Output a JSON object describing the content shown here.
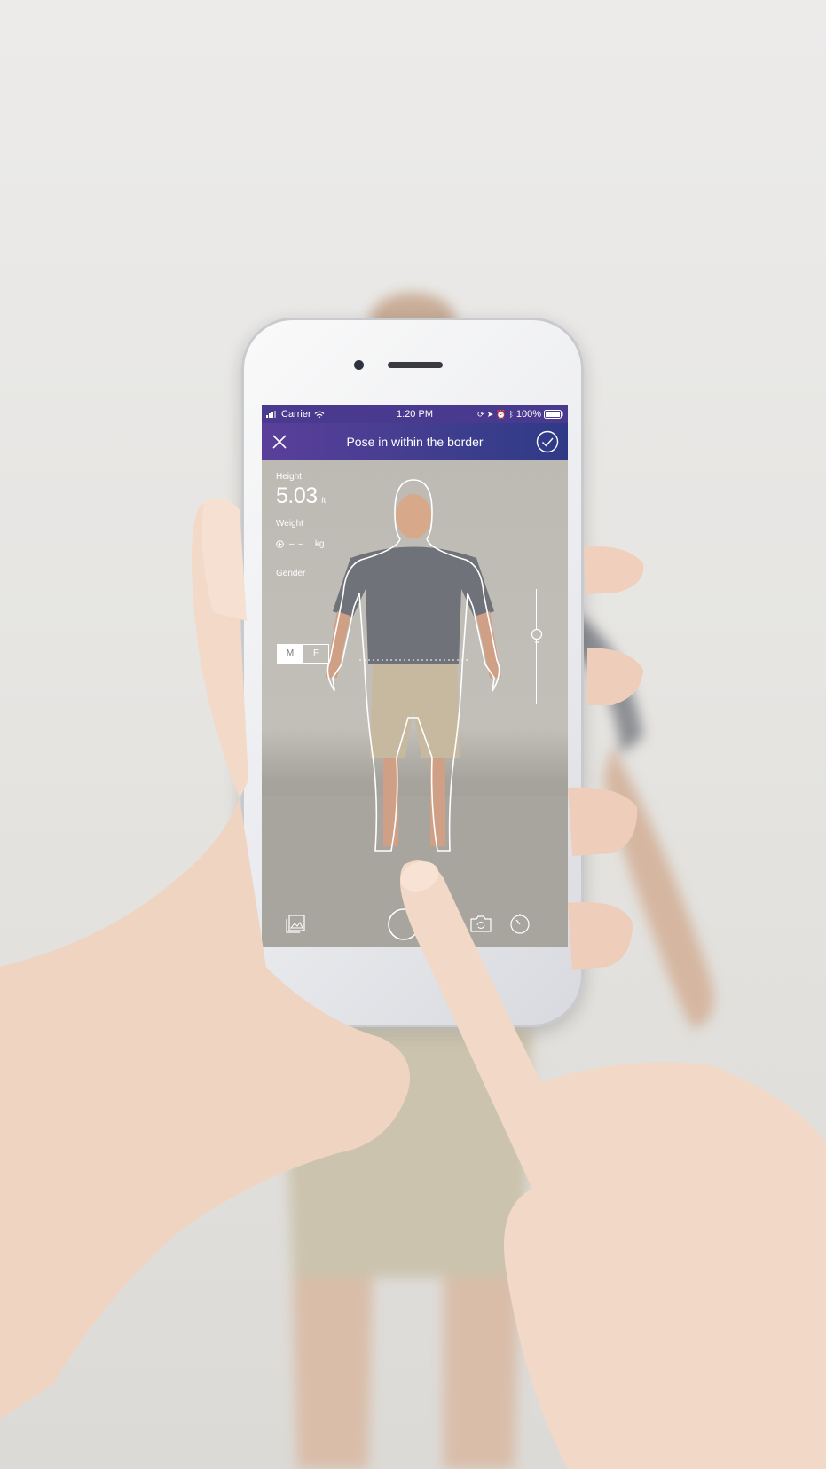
{
  "status_bar": {
    "carrier": "Carrier",
    "time": "1:20 PM",
    "battery": "100%"
  },
  "nav": {
    "title": "Pose in within the border",
    "close_icon": "close-icon",
    "confirm_icon": "checkmark-circle-icon"
  },
  "measurements": {
    "height_label": "Height",
    "height_value": "5.03",
    "height_unit": "ft",
    "weight_label": "Weight",
    "weight_value": "– –",
    "weight_unit": "kg",
    "gender_label": "Gender",
    "gender_options": [
      "M",
      "F"
    ],
    "gender_selected": "M"
  },
  "brightness_slider": {
    "icon": "lightbulb-icon",
    "level": 0.4
  },
  "bottom_toolbar": {
    "icons": [
      "gallery-icon",
      "shutter-button",
      "switch-camera-icon",
      "timer-icon"
    ]
  },
  "colors": {
    "header_start": "#5a3f9a",
    "header_end": "#2f3a86"
  }
}
